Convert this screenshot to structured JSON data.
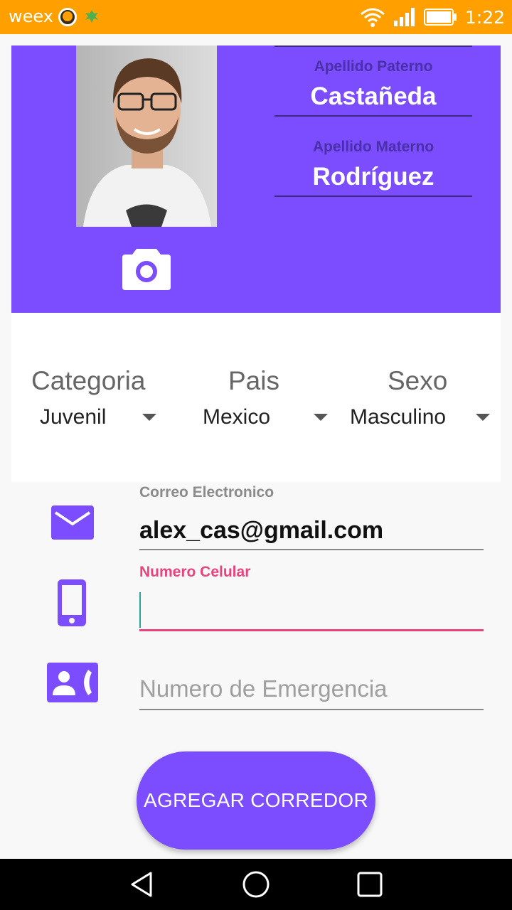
{
  "status_bar": {
    "app_name": "weex",
    "time": "1:22"
  },
  "header": {
    "apellido_paterno_label": "Apellido Paterno",
    "apellido_paterno_value": "Castañeda",
    "apellido_materno_label": "Apellido Materno",
    "apellido_materno_value": "Rodríguez",
    "accent_color": "#7c4dff"
  },
  "selects": {
    "categoria": {
      "label": "Categoria",
      "value": "Juvenil"
    },
    "pais": {
      "label": "Pais",
      "value": "Mexico"
    },
    "sexo": {
      "label": "Sexo",
      "value": "Masculino"
    }
  },
  "form": {
    "email": {
      "label": "Correo Electronico",
      "value": "alex_cas@gmail.com",
      "icon": "email-icon"
    },
    "phone": {
      "label": "Numero Celular",
      "value": "",
      "icon": "smartphone-icon",
      "focused_color": "#e8437c"
    },
    "emergency": {
      "placeholder": "Numero de Emergencia",
      "icon": "contact-phone-icon"
    }
  },
  "submit_button": "AGREGAR CORREDOR",
  "icons": {
    "camera": "camera-icon",
    "nav_back": "back-triangle-icon",
    "nav_home": "home-circle-icon",
    "nav_recents": "recents-square-icon"
  }
}
